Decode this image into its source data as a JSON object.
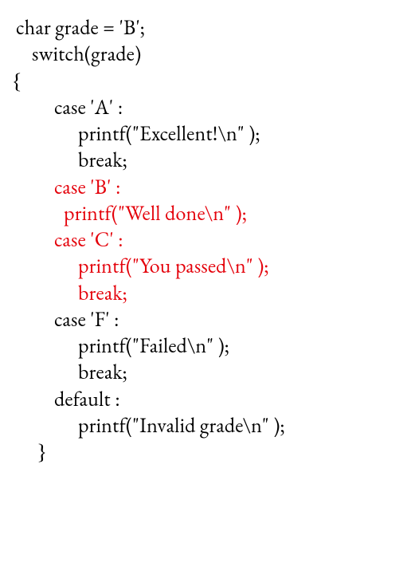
{
  "code": {
    "l1": "char grade = 'B';",
    "l2": "switch(grade)",
    "l3": "{",
    "l4": "case 'A' :",
    "l5": "printf(\"Excellent!\\n\" );",
    "l6": "break;",
    "l7": "case 'B' :",
    "l8": "printf(\"Well done\\n\" );",
    "l9": "case 'C' :",
    "l10": "printf(\"You passed\\n\" );",
    "l11": "break;",
    "l12": "case 'F' :",
    "l13": "printf(\"Failed\\n\" );",
    "l14": "break;",
    "l15": "default :",
    "l16": "printf(\"Invalid grade\\n\" );",
    "l17": "}"
  },
  "highlight_color": "#e4000a"
}
